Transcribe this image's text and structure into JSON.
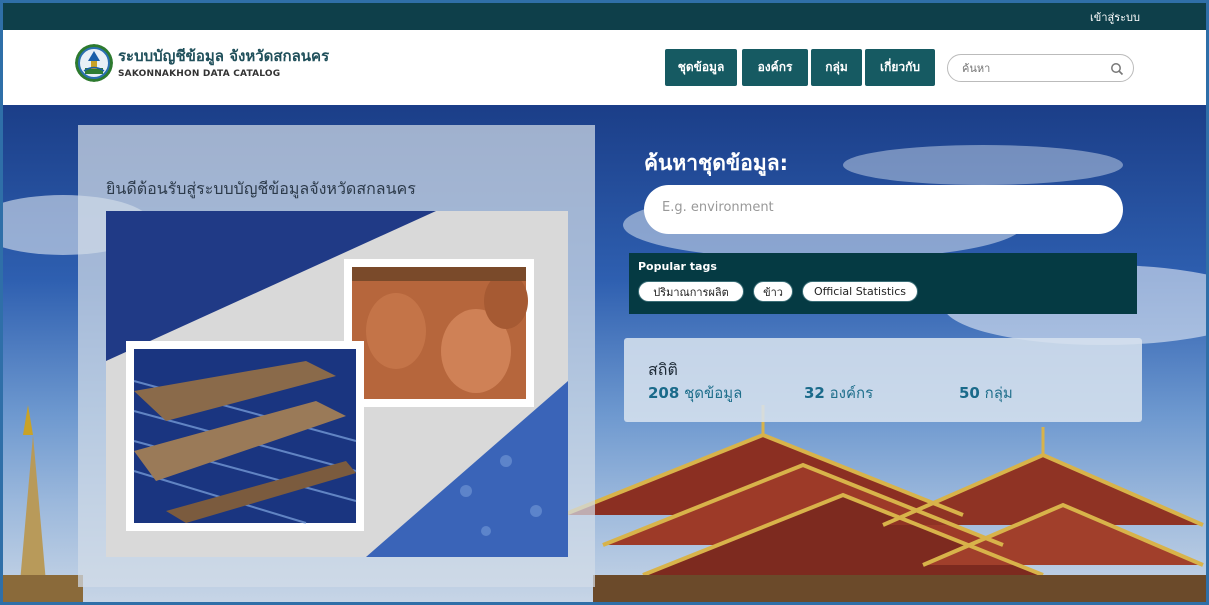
{
  "topbar": {
    "login_label": "เข้าสู่ระบบ"
  },
  "brand": {
    "title": "ระบบบัญชีข้อมูล จังหวัดสกลนคร",
    "subtitle": "SAKONNAKHON DATA CATALOG",
    "logo_icon": "province-seal-icon"
  },
  "nav": {
    "items": [
      {
        "label": "ชุดข้อมูล"
      },
      {
        "label": "องค์กร"
      },
      {
        "label": "กลุ่ม"
      },
      {
        "label": "เกี่ยวกับ"
      }
    ],
    "search": {
      "placeholder": "ค้นหา",
      "icon": "search-icon"
    }
  },
  "hero": {
    "welcome": "ยินดีต้อนรับสู่ระบบบัญชีข้อมูลจังหวัดสกลนคร",
    "search_title": "ค้นหาชุดข้อมูล:",
    "search_placeholder": "E.g. environment",
    "popular_tags_title": "Popular tags",
    "tags": [
      "ปริมาณการผลิต",
      "ข้าว",
      "Official Statistics"
    ],
    "stats": {
      "title": "สถิติ",
      "datasets_count": "208",
      "datasets_label": "ชุดข้อมูล",
      "orgs_count": "32",
      "orgs_label": "องค์กร",
      "groups_count": "50",
      "groups_label": "กลุ่ม"
    }
  },
  "colors": {
    "topbar": "#0e3f4a",
    "nav_button": "#165a62",
    "tags_box": "#053a43",
    "stat_text": "#1f6f8c"
  }
}
